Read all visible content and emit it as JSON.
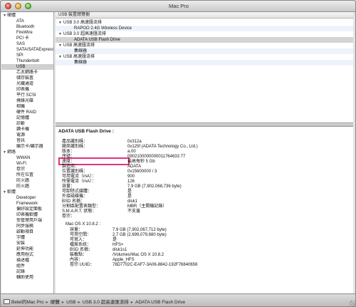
{
  "window": {
    "title": "Mac Pro"
  },
  "sidebar": {
    "groups": [
      {
        "label": "硬體",
        "items": [
          "ATA",
          "Bluetooth",
          "FireWire",
          "PCI 卡",
          "SAS",
          "SATA/SATAExpress",
          "SPI",
          "Thunderbolt",
          "USB",
          "乙太網路卡",
          "儲存裝置",
          "光纖通道",
          "印表機",
          "平行 SCSI",
          "燒錄光碟",
          "相機",
          "硬件 RAID",
          "記憶體",
          "診斷",
          "讀卡機",
          "電源",
          "音訊",
          "顯示卡/顯示器"
        ]
      },
      {
        "label": "網路",
        "items": [
          "WWAN",
          "Wi-Fi",
          "卷宗",
          "所在位置",
          "防火牆",
          "防火牆"
        ]
      },
      {
        "label": "軟體",
        "items": [
          "Developer",
          "Framework",
          "偏好設定面板",
          "印表機軟體",
          "受管理用戶端",
          "同步服務",
          "啟動項目",
          "字體",
          "安裝",
          "延伸功能",
          "應用程式",
          "描述檔",
          "組件",
          "記錄",
          "輔助使用"
        ]
      }
    ],
    "selected": "USB"
  },
  "top_pane": {
    "header": "USB 裝置總覽樹",
    "rows": [
      {
        "label": "USB 3.0 高速匯流排",
        "level": 0,
        "tri": "▼"
      },
      {
        "label": "RAPOO 2.4G Wireless Device",
        "level": 1,
        "tri": ""
      },
      {
        "label": "USB 3.0 超高速匯流排",
        "level": 0,
        "tri": "▼"
      },
      {
        "label": "ADATA USB Flash Drive",
        "level": 1,
        "tri": "",
        "selected": true
      },
      {
        "label": "USB 高速匯流排",
        "level": 0,
        "tri": "▼"
      },
      {
        "label": "集線器",
        "level": 1,
        "tri": ""
      },
      {
        "label": "USB 高速匯流排",
        "level": 0,
        "tri": "▼"
      },
      {
        "label": "集線器",
        "level": 1,
        "tri": ""
      }
    ]
  },
  "detail": {
    "title": "ADATA USB Flash Drive :",
    "props": [
      {
        "k": "產品識別碼：",
        "v": "0x312a"
      },
      {
        "k": "廠商識別碼：",
        "v": "0x125f  (ADATA Technology Co., Ltd.)"
      },
      {
        "k": "版本：",
        "v": "a.00"
      },
      {
        "k": "序號：",
        "v": "0902100000000011764633 77"
      },
      {
        "k": "速度：",
        "v": "最高每秒 5 Gb"
      },
      {
        "k": "製造商：",
        "v": "ADATA"
      },
      {
        "k": "位置識別碼：",
        "v": "0x15600000 / 3"
      },
      {
        "k": "可用電流（mA）：",
        "v": "900"
      },
      {
        "k": "所需電流（mA）：",
        "v": "126"
      },
      {
        "k": "容量：",
        "v": "7.9 GB (7,902,068,736 byte)"
      },
      {
        "k": "可卸除式媒體：",
        "v": "是"
      },
      {
        "k": "外接磁碟機：",
        "v": "是"
      },
      {
        "k": "BSD 名稱：",
        "v": "disk1"
      },
      {
        "k": "分割區配置表類型：",
        "v": "MBR（主開機記錄）"
      },
      {
        "k": "S.M.A.R.T. 狀態：",
        "v": "不支援"
      },
      {
        "k": "卷宗：",
        "v": ""
      }
    ],
    "volume": {
      "name": "Mac OS X 10.8.2 :",
      "props": [
        {
          "k": "容量：",
          "v": "7.9 GB (7,902,067,712 byte)"
        },
        {
          "k": "可用空間：",
          "v": "2.7 GB (2,699,079,680 byte)"
        },
        {
          "k": "可寫入：",
          "v": "是"
        },
        {
          "k": "檔案系統：",
          "v": "HFS+"
        },
        {
          "k": "BSD 名稱：",
          "v": "disk1s1"
        },
        {
          "k": "裝載點：",
          "v": "/Volumes/Mac OS X 10.8.2"
        },
        {
          "k": "內容：",
          "v": "Apple_HFS"
        },
        {
          "k": "卷宗 UUID：",
          "v": "78D7702C-EAF7-3A06-8842-192F76840656"
        }
      ]
    }
  },
  "statusbar": {
    "crumbs": [
      "Betel的Mac Pro",
      "硬體",
      "USB",
      "USB 3.0 超高速匯流排",
      "ADATA USB Flash Drive"
    ],
    "separator": "▸"
  },
  "colors": {
    "highlight": "#e0327d",
    "selected_row": "#d4d4d4"
  },
  "icons": {
    "computer": "computer-icon",
    "disclosure": "disclosure-triangle-icon"
  }
}
